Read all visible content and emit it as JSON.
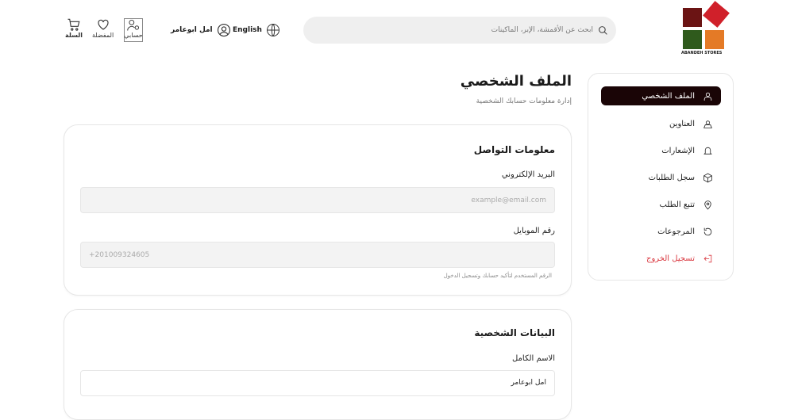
{
  "header": {
    "search_placeholder": "ابحث عن الأقمشة، الإبر، الماكينات",
    "logo_text": "ABANDEH STORES",
    "language": "English",
    "user_name": "امل ابوعامر",
    "account_label": "حسابي",
    "favorites_label": "المفضلة",
    "cart_label": "السلة"
  },
  "page": {
    "title": "الملف الشخصي",
    "subtitle": "إدارة معلومات حسابك الشخصية"
  },
  "sidebar": {
    "items": [
      {
        "label": "الملف الشخصي",
        "icon": "user-icon"
      },
      {
        "label": "العناوين",
        "icon": "address-icon"
      },
      {
        "label": "الإشعارات",
        "icon": "bell-icon"
      },
      {
        "label": "سجل الطلبات",
        "icon": "box-icon"
      },
      {
        "label": "تتبع الطلب",
        "icon": "location-pin-icon"
      },
      {
        "label": "المرجوعات",
        "icon": "refresh-icon"
      },
      {
        "label": "تسجيل الخروج",
        "icon": "logout-icon"
      }
    ]
  },
  "contact": {
    "title": "معلومات التواصل",
    "email_label": "البريد الإلكتروني",
    "email_placeholder": "example@email.com",
    "phone_label": "رقم الموبايل",
    "phone_value": "+201009324605",
    "phone_hint": "الرقم المستخدم لتأكيد حسابك وتسجيل الدخول"
  },
  "personal": {
    "title": "البيانات الشخصية",
    "fullname_label": "الاسم الكامل",
    "fullname_value": "امل ابوعامر"
  },
  "colors": {
    "accent": "#1a0506",
    "danger": "#d9363e"
  }
}
